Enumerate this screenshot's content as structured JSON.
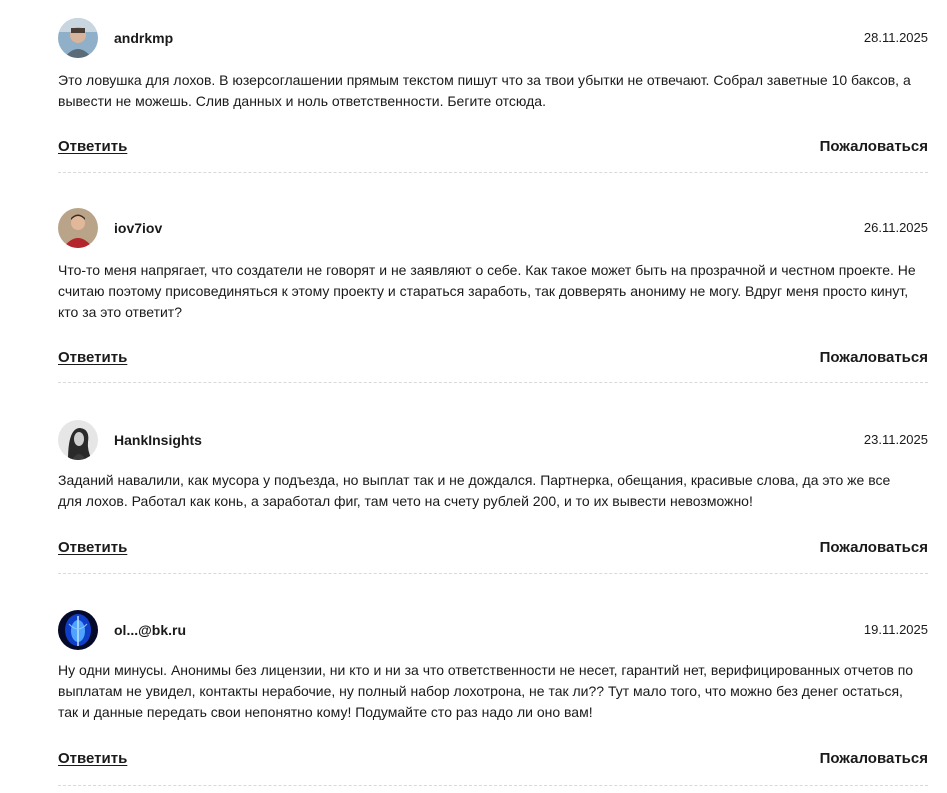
{
  "labels": {
    "reply": "Ответить",
    "report": "Пожаловаться"
  },
  "comments": [
    {
      "username": "andrkmp",
      "date": "28.11.2025",
      "text": "Это ловушка для лохов. В юзерсоглашении прямым текстом пишут что за твои убытки не отвечают. Собрал заветные 10 баксов, а вывести не можешь. Слив данных и ноль ответственности. Бегите отсюда.",
      "avatar_icon": "user-photo-avatar"
    },
    {
      "username": "iov7iov",
      "date": "26.11.2025",
      "text": "Что-то меня напрягает, что создатели не говорят и не заявляют о себе. Как такое может быть на прозрачной и честном проекте. Не считаю поэтому присовединяться к этому проекту и стараться заработь, так довверять анониму не могу. Вдруг меня просто кинут, кто за это ответит?",
      "avatar_icon": "user-photo-avatar"
    },
    {
      "username": "HankInsights",
      "date": "23.11.2025",
      "text": "Заданий навалили, как мусора у подъезда, но выплат так и не дождался. Партнерка, обещания, красивые слова, да это же все для лохов. Работал как конь, а заработал фиг, там чето на счету рублей 200, и то их вывести невозможно!",
      "avatar_icon": "user-photo-avatar"
    },
    {
      "username": "ol...@bk.ru",
      "date": "19.11.2025",
      "text": "Ну одни минусы. Анонимы без лицензии, ни кто и ни за что ответственности не несет, гарантий нет, верифицированных отчетов по выплатам не увидел, контакты нерабочие, ну полный набор лохотрона, не так ли?? Тут мало того, что можно без денег остаться, так и данные передать свои непонятно кому! Подумайте сто раз надо ли оно вам!",
      "avatar_icon": "user-photo-avatar"
    }
  ]
}
